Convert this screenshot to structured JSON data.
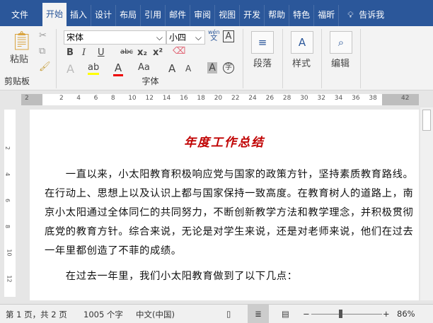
{
  "tabs": [
    "文件",
    "开始",
    "插入",
    "设计",
    "布局",
    "引用",
    "邮件",
    "审阅",
    "视图",
    "开发",
    "帮助",
    "特色",
    "福昕"
  ],
  "tell_me": "告诉我",
  "ribbon": {
    "clipboard": {
      "paste": "粘贴",
      "label": "剪贴板"
    },
    "font": {
      "name": "宋体",
      "size": "小四",
      "label": "字体",
      "pinyin_top": "wén",
      "pinyin_bottom": "文",
      "bold": "B",
      "italic": "I",
      "underline": "U",
      "strike": "abc",
      "sub": "x₂",
      "sup": "x²",
      "case": "Aa",
      "grow": "A",
      "shrink": "A",
      "shade": "A",
      "enclose": "字",
      "effects": "A",
      "highlight": "ab",
      "color": "A",
      "border": "A"
    },
    "paragraph": "段落",
    "styles": "样式",
    "editing": "编辑"
  },
  "ruler": [
    "2",
    "2",
    "4",
    "6",
    "8",
    "10",
    "12",
    "14",
    "16",
    "18",
    "20",
    "22",
    "24",
    "26",
    "28",
    "30",
    "32",
    "34",
    "36",
    "38",
    "42"
  ],
  "vruler": [
    "2",
    "4",
    "6",
    "8",
    "10",
    "12"
  ],
  "document": {
    "title": "年度工作总结",
    "lines": [
      "　　一直以来，小太阳教育积极响应党与国家的政策方针，坚持素质教育路线。",
      "在行动上、思想上以及认识上都与国家保持一致高度。在教育树人的道路上，南",
      "京小太阳通过全体同仁的共同努力，不断创新教学方法和教学理念，并积极贯彻",
      "底党的教育方针。综合来说，无论是对学生来说，还是对老师来说，他们在过去",
      "一年里都创造了不菲的成绩。",
      "　　在过去一年里，我们小太阳教育做到了以下几点："
    ]
  },
  "status": {
    "page": "第 1 页，共 2 页",
    "words": "1005 个字",
    "lang": "中文(中国)",
    "zoom": "86%",
    "zoom_level_percent": 86
  },
  "colors": {
    "accent": "#2b579a",
    "title": "#c00000"
  }
}
